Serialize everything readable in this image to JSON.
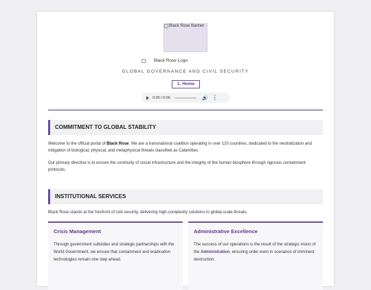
{
  "header": {
    "banner_alt": "Black Rose Banner",
    "logo_alt": "Black Rose Logo",
    "tagline": "GLOBAL GOVERNANCE AND CIVIL SECURITY",
    "nav_home": "1. Home"
  },
  "audio": {
    "time": "0:00 / 0:00"
  },
  "commitment": {
    "heading": "COMMITMENT TO GLOBAL STABILITY",
    "p1_prefix": "Welcome to the official portal of ",
    "p1_bold": "Black Rose",
    "p1_suffix": ". We are a transnational coalition operating in over 120 countries, dedicated to the neutralization and mitigation of biological, physical, and metaphysical threats classified as Calamities.",
    "p2": "Our primary directive is to ensure the continuity of social infrastructure and the integrity of the human biosphere through rigorous containment protocols."
  },
  "services": {
    "heading": "INSTITUTIONAL SERVICES",
    "intro": "Black Rose stands at the forefront of civil security, delivering high-complexity solutions to global-scale threats.",
    "cards": [
      {
        "title": "Crisis Management",
        "text": "Through government subsidies and strategic partnerships with the World Government, we ensure that containment and eradication technologies remain one step ahead."
      },
      {
        "title": "Administrative Excellence",
        "text_prefix": "The success of our operations is the result of the strategic vision of the ",
        "text_link": "Administration",
        "text_suffix": ", ensuring order even in scenarios of imminent destruction."
      }
    ]
  }
}
